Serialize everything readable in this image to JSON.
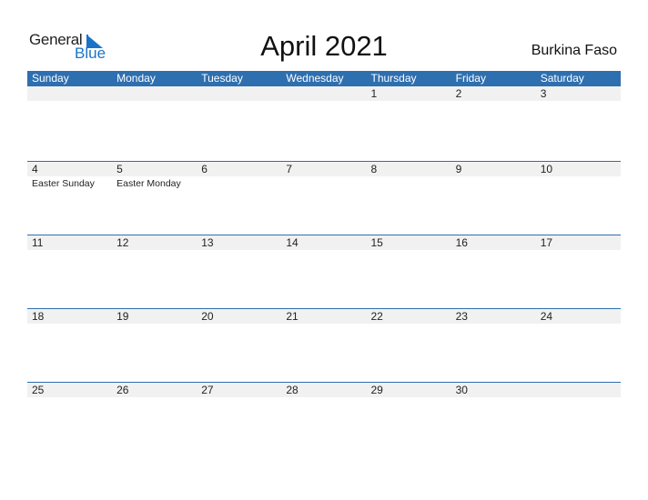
{
  "logo": {
    "general": "General",
    "blue": "Blue"
  },
  "title": "April 2021",
  "country": "Burkina Faso",
  "weekdays": [
    "Sunday",
    "Monday",
    "Tuesday",
    "Wednesday",
    "Thursday",
    "Friday",
    "Saturday"
  ],
  "weeks": [
    {
      "days": [
        "",
        "",
        "",
        "",
        "1",
        "2",
        "3"
      ],
      "events": [
        "",
        "",
        "",
        "",
        "",
        "",
        ""
      ]
    },
    {
      "days": [
        "4",
        "5",
        "6",
        "7",
        "8",
        "9",
        "10"
      ],
      "events": [
        "Easter Sunday",
        "Easter Monday",
        "",
        "",
        "",
        "",
        ""
      ]
    },
    {
      "days": [
        "11",
        "12",
        "13",
        "14",
        "15",
        "16",
        "17"
      ],
      "events": [
        "",
        "",
        "",
        "",
        "",
        "",
        ""
      ]
    },
    {
      "days": [
        "18",
        "19",
        "20",
        "21",
        "22",
        "23",
        "24"
      ],
      "events": [
        "",
        "",
        "",
        "",
        "",
        "",
        ""
      ]
    },
    {
      "days": [
        "25",
        "26",
        "27",
        "28",
        "29",
        "30",
        ""
      ],
      "events": [
        "",
        "",
        "",
        "",
        "",
        "",
        ""
      ]
    }
  ]
}
